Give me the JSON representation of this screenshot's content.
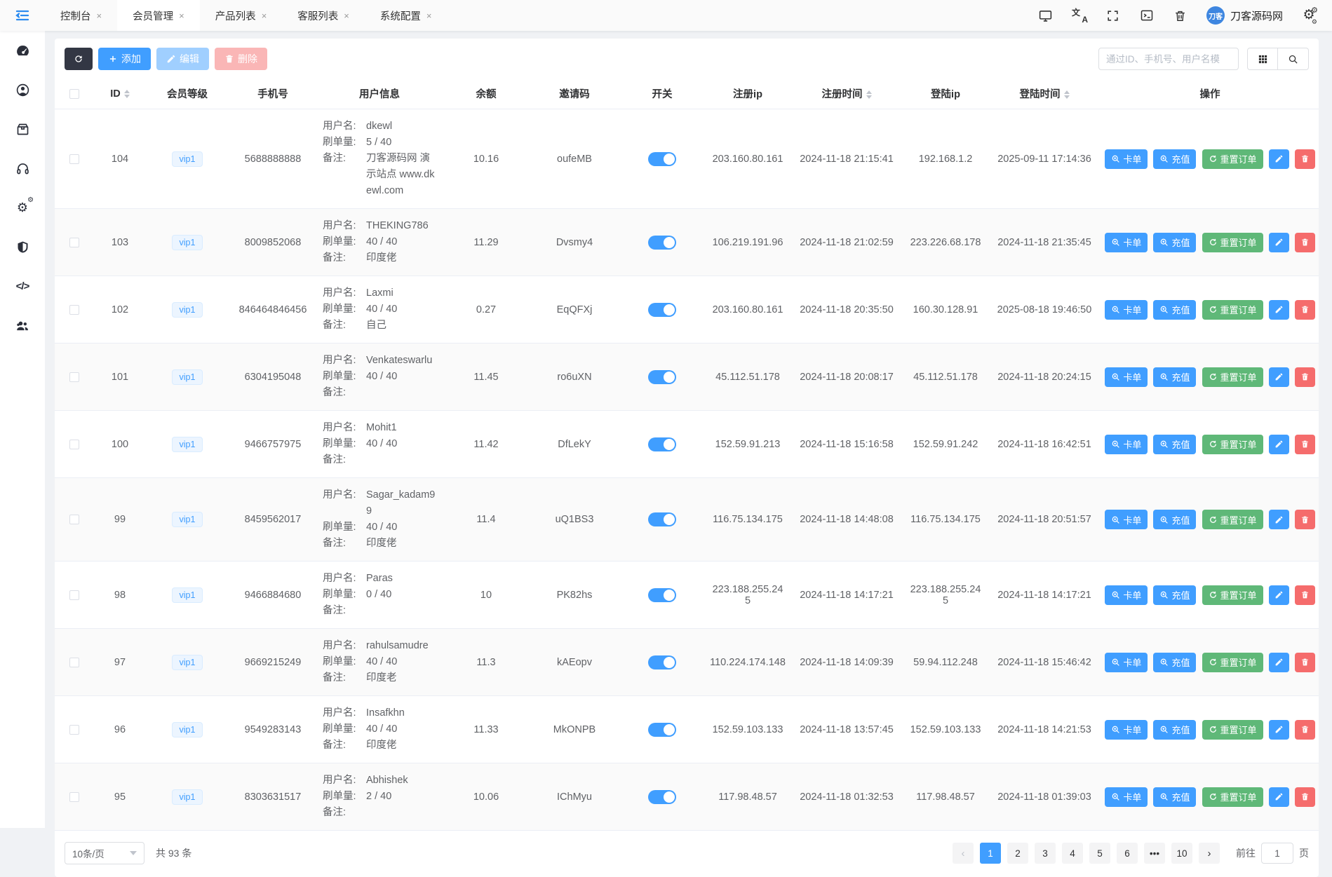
{
  "topbar": {
    "tabs": [
      {
        "label": "控制台",
        "active": false
      },
      {
        "label": "会员管理",
        "active": true
      },
      {
        "label": "产品列表",
        "active": false
      },
      {
        "label": "客服列表",
        "active": false
      },
      {
        "label": "系统配置",
        "active": false
      }
    ],
    "close_glyph": "×",
    "brand_name": "刀客源码网",
    "brand_mark": "刀客"
  },
  "toolbar": {
    "add_label": "添加",
    "edit_label": "编辑",
    "delete_label": "删除",
    "search_placeholder": "通过ID、手机号、用户名模"
  },
  "table": {
    "columns": [
      {
        "label": "ID",
        "sortable": true
      },
      {
        "label": "会员等级"
      },
      {
        "label": "手机号"
      },
      {
        "label": "用户信息"
      },
      {
        "label": "余额"
      },
      {
        "label": "邀请码"
      },
      {
        "label": "开关"
      },
      {
        "label": "注册ip"
      },
      {
        "label": "注册时间",
        "sortable": true
      },
      {
        "label": "登陆ip"
      },
      {
        "label": "登陆时间",
        "sortable": true
      },
      {
        "label": "操作"
      }
    ],
    "labels": {
      "username": "用户名:",
      "orders": "刷单量:",
      "remark": "备注:"
    },
    "action_labels": {
      "card": "卡单",
      "recharge": "充值",
      "reset": "重置订单"
    },
    "rows": [
      {
        "id": "104",
        "level": "vip1",
        "phone": "5688888888",
        "username": "dkewl",
        "orders": "5 / 40",
        "remark": "刀客源码网 演示站点 www.dkewl.com",
        "balance": "10.16",
        "invite": "oufeMB",
        "reg_ip": "203.160.80.161",
        "reg_time": "2024-11-18 21:15:41",
        "login_ip": "192.168.1.2",
        "login_time": "2025-09-11 17:14:36"
      },
      {
        "id": "103",
        "level": "vip1",
        "phone": "8009852068",
        "username": "THEKING786",
        "orders": "40 / 40",
        "remark": "印度佬",
        "balance": "11.29",
        "invite": "Dvsmy4",
        "reg_ip": "106.219.191.96",
        "reg_time": "2024-11-18 21:02:59",
        "login_ip": "223.226.68.178",
        "login_time": "2024-11-18 21:35:45"
      },
      {
        "id": "102",
        "level": "vip1",
        "phone": "846464846456",
        "username": "Laxmi",
        "orders": "40 / 40",
        "remark": "自己",
        "balance": "0.27",
        "invite": "EqQFXj",
        "reg_ip": "203.160.80.161",
        "reg_time": "2024-11-18 20:35:50",
        "login_ip": "160.30.128.91",
        "login_time": "2025-08-18 19:46:50"
      },
      {
        "id": "101",
        "level": "vip1",
        "phone": "6304195048",
        "username": "Venkateswarlu",
        "orders": "40 / 40",
        "remark": "",
        "balance": "11.45",
        "invite": "ro6uXN",
        "reg_ip": "45.112.51.178",
        "reg_time": "2024-11-18 20:08:17",
        "login_ip": "45.112.51.178",
        "login_time": "2024-11-18 20:24:15"
      },
      {
        "id": "100",
        "level": "vip1",
        "phone": "9466757975",
        "username": "Mohit1",
        "orders": "40 / 40",
        "remark": "",
        "balance": "11.42",
        "invite": "DfLekY",
        "reg_ip": "152.59.91.213",
        "reg_time": "2024-11-18 15:16:58",
        "login_ip": "152.59.91.242",
        "login_time": "2024-11-18 16:42:51"
      },
      {
        "id": "99",
        "level": "vip1",
        "phone": "8459562017",
        "username": "Sagar_kadam99",
        "orders": "40 / 40",
        "remark": "印度佬",
        "balance": "11.4",
        "invite": "uQ1BS3",
        "reg_ip": "116.75.134.175",
        "reg_time": "2024-11-18 14:48:08",
        "login_ip": "116.75.134.175",
        "login_time": "2024-11-18 20:51:57"
      },
      {
        "id": "98",
        "level": "vip1",
        "phone": "9466884680",
        "username": "Paras",
        "orders": "0 / 40",
        "remark": "",
        "balance": "10",
        "invite": "PK82hs",
        "reg_ip": "223.188.255.245",
        "reg_time": "2024-11-18 14:17:21",
        "login_ip": "223.188.255.245",
        "login_time": "2024-11-18 14:17:21"
      },
      {
        "id": "97",
        "level": "vip1",
        "phone": "9669215249",
        "username": "rahulsamudre",
        "orders": "40 / 40",
        "remark": "印度老",
        "balance": "11.3",
        "invite": "kAEopv",
        "reg_ip": "110.224.174.148",
        "reg_time": "2024-11-18 14:09:39",
        "login_ip": "59.94.112.248",
        "login_time": "2024-11-18 15:46:42"
      },
      {
        "id": "96",
        "level": "vip1",
        "phone": "9549283143",
        "username": "Insafkhn",
        "orders": "40 / 40",
        "remark": "印度佬",
        "balance": "11.33",
        "invite": "MkONPB",
        "reg_ip": "152.59.103.133",
        "reg_time": "2024-11-18 13:57:45",
        "login_ip": "152.59.103.133",
        "login_time": "2024-11-18 14:21:53"
      },
      {
        "id": "95",
        "level": "vip1",
        "phone": "8303631517",
        "username": "Abhishek",
        "orders": "2 / 40",
        "remark": "",
        "balance": "10.06",
        "invite": "IChMyu",
        "reg_ip": "117.98.48.57",
        "reg_time": "2024-11-18 01:32:53",
        "login_ip": "117.98.48.57",
        "login_time": "2024-11-18 01:39:03"
      }
    ]
  },
  "pagination": {
    "page_size": "10条/页",
    "total": "共 93 条",
    "pages": [
      "1",
      "2",
      "3",
      "4",
      "5",
      "6",
      "•••",
      "10"
    ],
    "active": "1",
    "prev": "‹",
    "next": "›",
    "goto_label": "前往",
    "goto_value": "1",
    "page_unit": "页"
  }
}
